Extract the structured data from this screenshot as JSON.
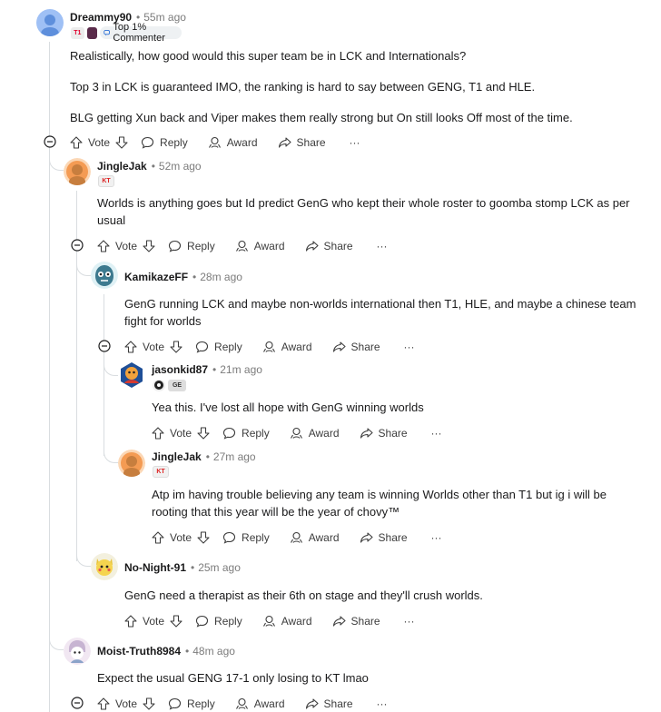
{
  "comments": [
    {
      "author": "Dreammy90",
      "time": "55m ago",
      "badge": "Top 1% Commenter",
      "paragraphs": [
        "Realistically, how good would this super team be in LCK and Internationals?",
        "Top 3 in LCK is guaranteed IMO, the ranking is hard to say between GENG, T1 and HLE.",
        "BLG getting Xun back and Viper makes them really strong but On still looks Off most of the time."
      ],
      "colors": {
        "avatar": "#8cb4f0"
      }
    },
    {
      "author": "JingleJak",
      "time": "52m ago",
      "paragraphs": [
        "Worlds is anything goes but Id predict GenG who kept their whole roster to goomba stomp LCK as per usual"
      ],
      "colors": {
        "avatar": "#f4a25a"
      }
    },
    {
      "author": "KamikazeFF",
      "time": "28m ago",
      "paragraphs": [
        "GenG running LCK and maybe non-worlds international then T1, HLE, and maybe a chinese team fight for worlds"
      ],
      "colors": {
        "avatar": "#3c6e8c"
      }
    },
    {
      "author": "jasonkid87",
      "time": "21m ago",
      "paragraphs": [
        "Yea this. I've lost all hope with GenG winning worlds"
      ],
      "colors": {
        "avatar": "#2b4d8c"
      }
    },
    {
      "author": "JingleJak",
      "time": "27m ago",
      "paragraphs": [
        "Atp im having trouble believing any team is winning Worlds other than T1 but ig i will be rooting that this year will be the year of chovy™"
      ],
      "colors": {
        "avatar": "#f4a25a"
      }
    },
    {
      "author": "No-Night-91",
      "time": "25m ago",
      "paragraphs": [
        "GenG need a therapist as their 6th on stage and they'll crush worlds."
      ],
      "colors": {
        "avatar": "#f6d95a"
      }
    },
    {
      "author": "Moist-Truth8984",
      "time": "48m ago",
      "paragraphs": [
        "Expect the usual GENG 17-1 only losing to KT lmao"
      ],
      "colors": {
        "avatar": "#f3eaf4"
      }
    }
  ],
  "actions": {
    "vote": "Vote",
    "reply": "Reply",
    "award": "Award",
    "share": "Share",
    "more": "···"
  },
  "icons": [
    "upvote-icon",
    "downvote-icon",
    "reply-icon",
    "award-icon",
    "share-icon",
    "collapse-icon",
    "more-icon"
  ]
}
